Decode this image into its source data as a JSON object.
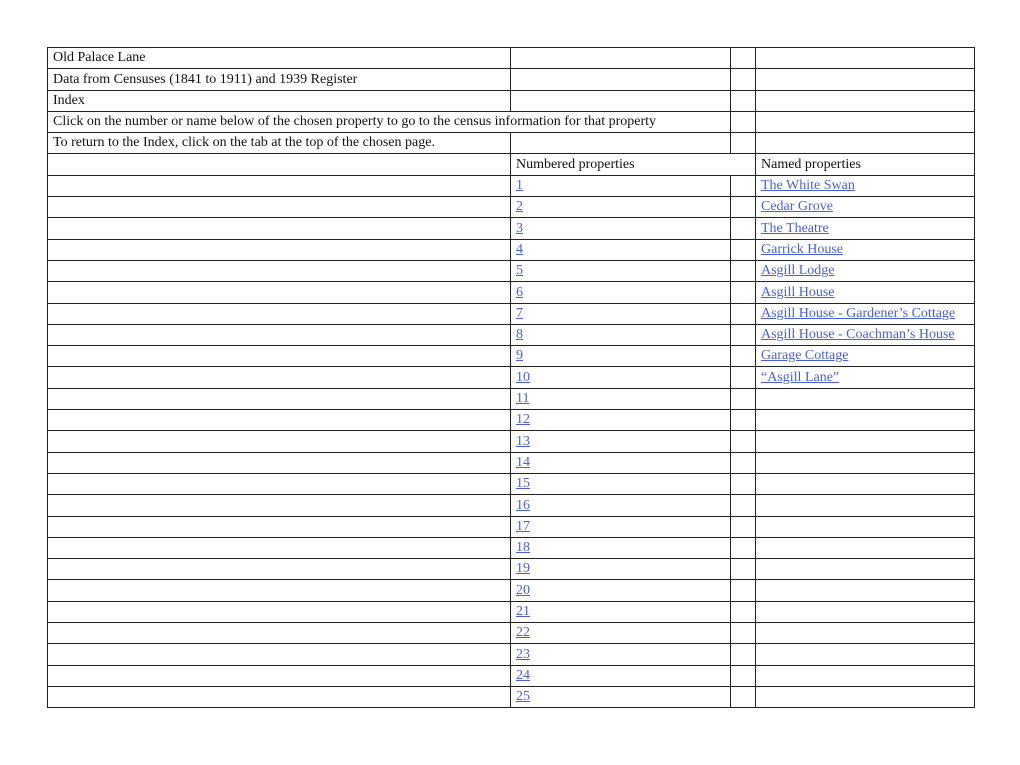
{
  "header_rows": [
    "Old Palace Lane",
    "Data from Censuses (1841 to 1911) and 1939 Register",
    "Index",
    "Click on the number or name below of the chosen property to go to the census information for that property",
    "To return to the Index, click on the tab at the top of the chosen page."
  ],
  "column_headers": {
    "numbered": "Numbered properties",
    "named": "Named properties"
  },
  "numbered_properties": [
    "1",
    "2",
    "3",
    "4",
    "5",
    "6",
    "7",
    "8",
    "9",
    "10",
    "11",
    "12",
    "13",
    "14",
    "15",
    "16",
    "17",
    "18",
    "19",
    "20",
    "21",
    "22",
    "23",
    "24",
    "25"
  ],
  "named_properties": [
    "The White Swan",
    "Cedar Grove",
    "The Theatre",
    "Garrick House",
    "Asgill Lodge",
    "Asgill House",
    "Asgill House - Gardener’s Cottage",
    "Asgill House - Coachman’s House",
    "Garage Cottage",
    "“Asgill Lane”"
  ],
  "colors": {
    "link": "#4a5fd6",
    "grid": "#222222"
  }
}
